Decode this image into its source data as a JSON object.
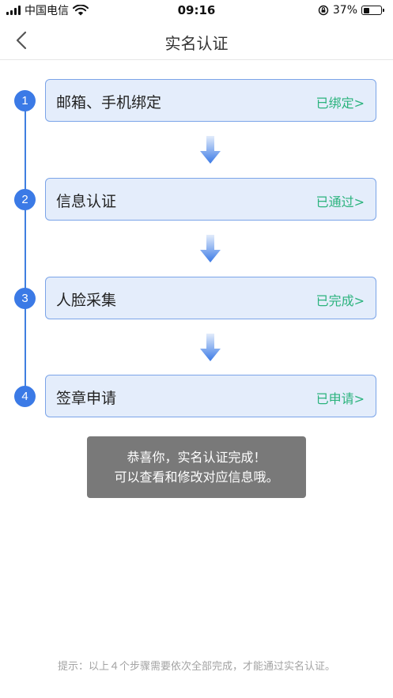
{
  "status_bar": {
    "carrier": "中国电信",
    "time": "09:16",
    "battery_percent": "37%",
    "battery_level": 0.37
  },
  "nav": {
    "title": "实名认证",
    "back_icon": "chevron-left-icon"
  },
  "steps": [
    {
      "number": "1",
      "title": "邮箱、手机绑定",
      "status": "已绑定>"
    },
    {
      "number": "2",
      "title": "信息认证",
      "status": "已通过>"
    },
    {
      "number": "3",
      "title": "人脸采集",
      "status": "已完成>"
    },
    {
      "number": "4",
      "title": "签章申请",
      "status": "已申请>"
    }
  ],
  "toast": {
    "line1": "恭喜你，实名认证完成！",
    "line2": "可以查看和修改对应信息哦。"
  },
  "footer": {
    "tip": "提示：以上４个步骤需要依次全部完成，才能通过实名认证。"
  },
  "colors": {
    "accent": "#3b7ae6",
    "card_bg": "#e4edfb",
    "card_border": "#7ba4e8",
    "status_green": "#2bb37d"
  }
}
